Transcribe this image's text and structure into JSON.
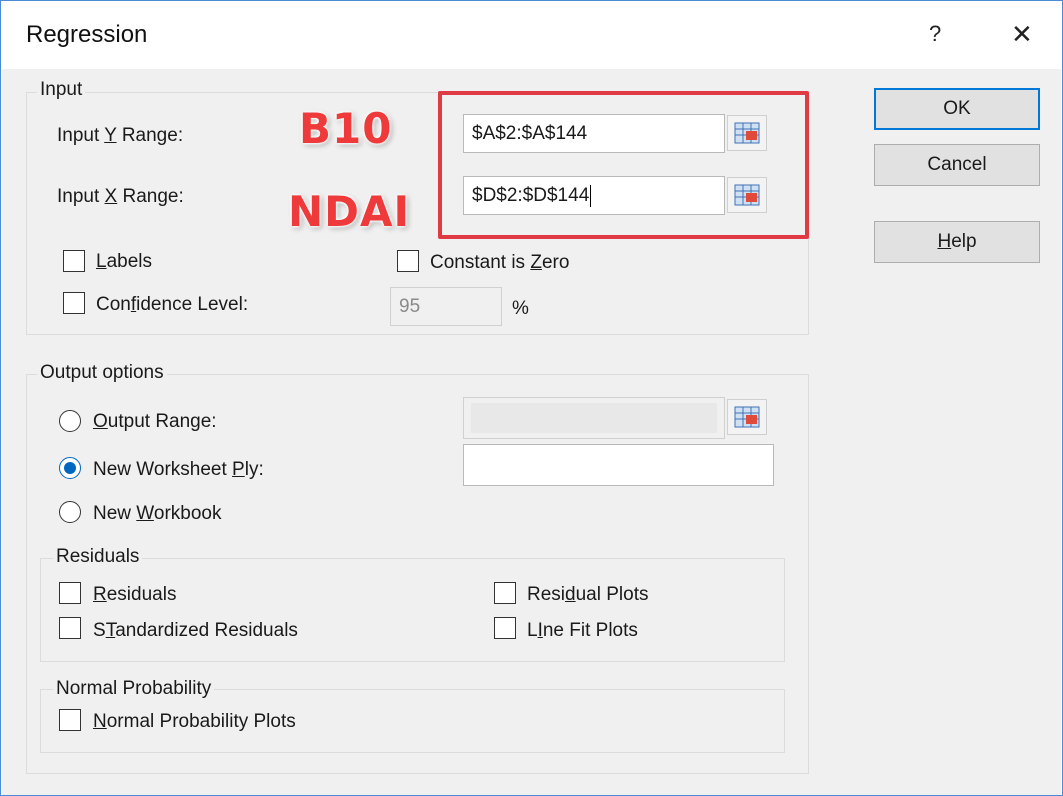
{
  "window": {
    "title": "Regression",
    "help_glyph": "?",
    "close_glyph": "✕"
  },
  "input_group": {
    "legend": "Input",
    "y_range": {
      "label_pre": "Input ",
      "label_key": "Y",
      "label_post": " Range:",
      "value": "$A$2:$A$144"
    },
    "x_range": {
      "label_pre": "Input ",
      "label_key": "X",
      "label_post": " Range:",
      "value": "$D$2:$D$144"
    },
    "labels": {
      "key": "L",
      "rest": "abels",
      "checked": false
    },
    "constant_zero": {
      "pre": "Constant is ",
      "key": "Z",
      "post": "ero",
      "checked": false
    },
    "confidence": {
      "pre": "Con",
      "key": "f",
      "post": "idence Level:",
      "checked": false,
      "value": "95",
      "unit": "%"
    }
  },
  "annotations": {
    "y_note": "B10",
    "x_note": "NDAI",
    "highlight_color": "#e03a44"
  },
  "buttons": {
    "ok": "OK",
    "cancel": "Cancel",
    "help": {
      "key": "H",
      "rest": "elp"
    }
  },
  "output_group": {
    "legend": "Output options",
    "output_range": {
      "key": "O",
      "rest": "utput Range:",
      "selected": false,
      "value": ""
    },
    "new_ply": {
      "pre": "New Worksheet ",
      "key": "P",
      "post": "ly:",
      "selected": true,
      "value": ""
    },
    "new_workbook": {
      "pre": "New ",
      "key": "W",
      "post": "orkbook",
      "selected": false
    }
  },
  "residuals_group": {
    "legend": "Residuals",
    "residuals": {
      "key": "R",
      "rest": "esiduals",
      "checked": false
    },
    "standardized": {
      "key": "T",
      "pre": "S",
      "post": "andardized Residuals",
      "checked": false
    },
    "residual_plots": {
      "pre": "Resi",
      "key": "d",
      "post": "ual Plots",
      "checked": false
    },
    "line_fit": {
      "key": "I",
      "pre": "L",
      "post": "ne Fit Plots",
      "checked": false
    }
  },
  "normal_group": {
    "legend": "Normal Probability",
    "plots": {
      "key": "N",
      "rest": "ormal Probability Plots",
      "checked": false
    }
  },
  "icons": {
    "range_selector": "range-select-icon",
    "accent": "#0078d7"
  }
}
